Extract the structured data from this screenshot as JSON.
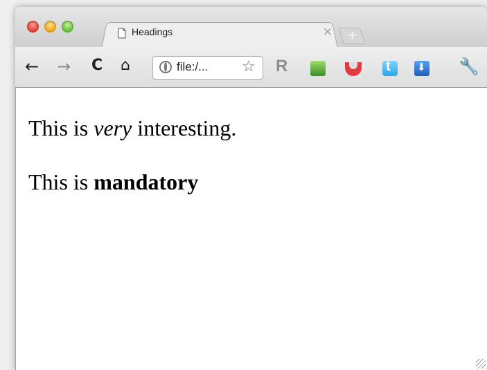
{
  "window": {
    "tab": {
      "title": "Headings",
      "close_symbol": "×",
      "favicon": "page-icon"
    },
    "new_tab_symbol": "+",
    "toolbar": {
      "back_icon": "back-arrow-icon",
      "forward_icon": "forward-arrow-icon",
      "reload_icon": "reload-icon",
      "home_icon": "home-icon",
      "url": "file:/...",
      "extensions": [
        "r-extension-icon",
        "green-extension-icon",
        "magnet-extension-icon",
        "twitter-extension-icon",
        "download-extension-icon"
      ],
      "ext_r_label": "R",
      "ext_twitter_label": "t",
      "wrench_icon": "wrench-icon"
    }
  },
  "page": {
    "paragraph1": {
      "before": "This is ",
      "emphasis": "very",
      "after": " interesting."
    },
    "paragraph2": {
      "before": "This is ",
      "strong": "mandatory"
    }
  },
  "colors": {
    "close_red": "#e0443a",
    "minimize_yellow": "#f0a81e",
    "zoom_green": "#6cc43c"
  }
}
